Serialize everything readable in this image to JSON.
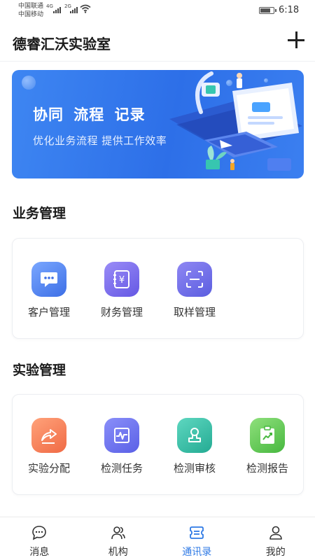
{
  "status_bar": {
    "carrier_1": "中国联通",
    "carrier_2": "中国移动",
    "network_1": "4G",
    "network_2": "2G",
    "battery_level": 0.85,
    "time": "6:18"
  },
  "header": {
    "title": "德睿汇沃实验室",
    "add_icon": "plus-icon"
  },
  "banner": {
    "headline": "协同 流程 记录",
    "subtitle": "优化业务流程 提供工作效率"
  },
  "business": {
    "title": "业务管理",
    "items": [
      {
        "label": "客户管理",
        "icon": "chat-bubble-icon",
        "color": "#4a7ff0"
      },
      {
        "label": "财务管理",
        "icon": "ledger-icon",
        "color": "#7a6ff0"
      },
      {
        "label": "取样管理",
        "icon": "scan-icon",
        "color": "#6d6de8"
      }
    ]
  },
  "lab": {
    "title": "实验管理",
    "items": [
      {
        "label": "实验分配",
        "icon": "share-arrow-icon",
        "color": "#f47a52"
      },
      {
        "label": "检测任务",
        "icon": "monitor-wave-icon",
        "color": "#6a70ea"
      },
      {
        "label": "检测审核",
        "icon": "user-stamp-icon",
        "color": "#30b59c"
      },
      {
        "label": "检测报告",
        "icon": "clipboard-chart-icon",
        "color": "#55c248"
      }
    ]
  },
  "bottom_nav": {
    "active_color": "#2f7ae5",
    "items": [
      {
        "label": "消息",
        "icon": "message-icon"
      },
      {
        "label": "机构",
        "icon": "people-icon"
      },
      {
        "label": "通讯录",
        "icon": "contacts-card-icon"
      },
      {
        "label": "我的",
        "icon": "user-icon"
      }
    ]
  }
}
